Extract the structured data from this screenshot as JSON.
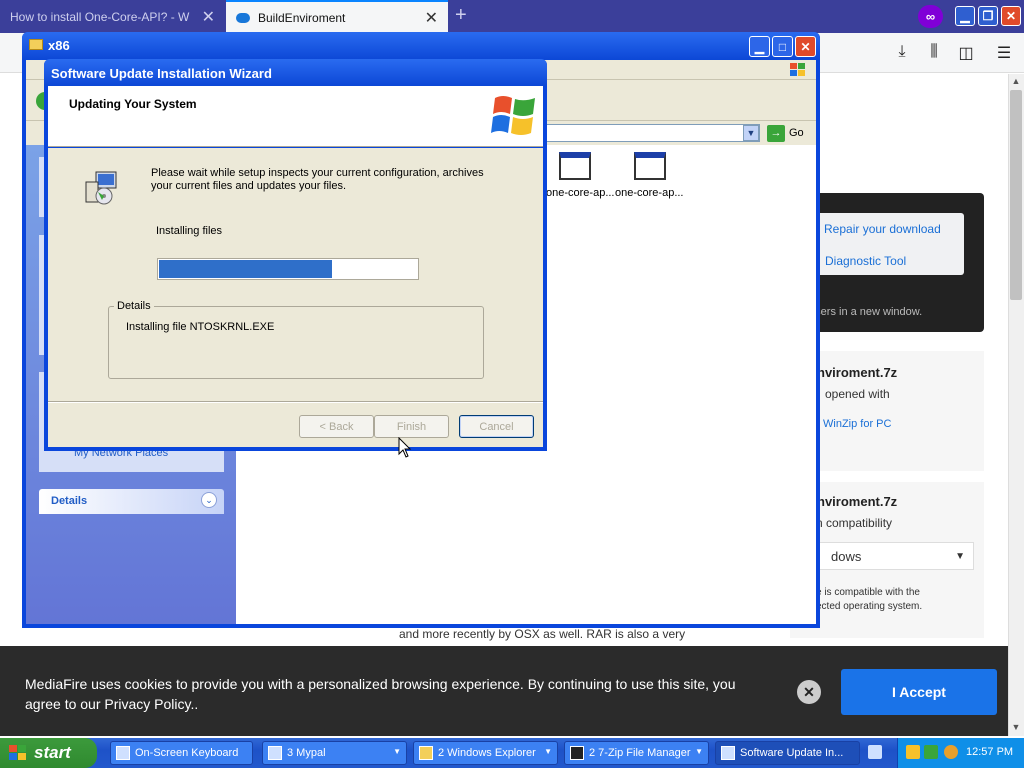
{
  "browser": {
    "tabs": [
      {
        "label": "How to install One-Core-API? - W"
      },
      {
        "label": "BuildEnviroment"
      }
    ],
    "new_tab_symbol": "+",
    "private_symbol": "∞"
  },
  "page": {
    "links": [
      "Repair your download",
      "Diagnostic Tool"
    ],
    "advert_note": "rtisers in a new window.",
    "card1": {
      "title": "nviroment.7z",
      "subtitle": "opened with",
      "link": "WinZip for PC"
    },
    "card2": {
      "title": "nviroment.7z",
      "subtitle": "n compatibility",
      "select_value": "dows",
      "note_line1": "e is compatible with the",
      "note_line2": "ected operating system."
    },
    "body_line": "and more recently by OSX as well. RAR is also a very"
  },
  "cookie": {
    "text": "MediaFire uses cookies to provide you with a personalized browsing experience. By continuing to use this site, you agree to our Privacy Policy..",
    "close_symbol": "✕",
    "accept_label": "I Accept"
  },
  "explorer": {
    "title": "x86",
    "go_label": "Go",
    "files": [
      "one-core-ap...",
      "one-core-ap..."
    ],
    "network_places": "My Network Places",
    "details_label": "Details"
  },
  "wizard": {
    "title": "Software Update Installation Wizard",
    "header_title": "Updating Your System",
    "message": "Please wait while setup inspects your current configuration, archives your current files and updates your files.",
    "status": "Installing files",
    "progress": 0.67,
    "details_label": "Details",
    "details_text": "Installing file NTOSKRNL.EXE",
    "buttons": {
      "back": "< Back",
      "finish": "Finish",
      "cancel": "Cancel"
    }
  },
  "taskbar": {
    "start_label": "start",
    "items": [
      "On-Screen Keyboard",
      "3 Mypal",
      "2 Windows Explorer",
      "2 7-Zip File Manager",
      "Software Update In..."
    ],
    "time": "12:57 PM"
  },
  "colors": {
    "xp_blue": "#0a46dc",
    "accent": "#1a73e8",
    "progress": "#2f6fc9"
  }
}
